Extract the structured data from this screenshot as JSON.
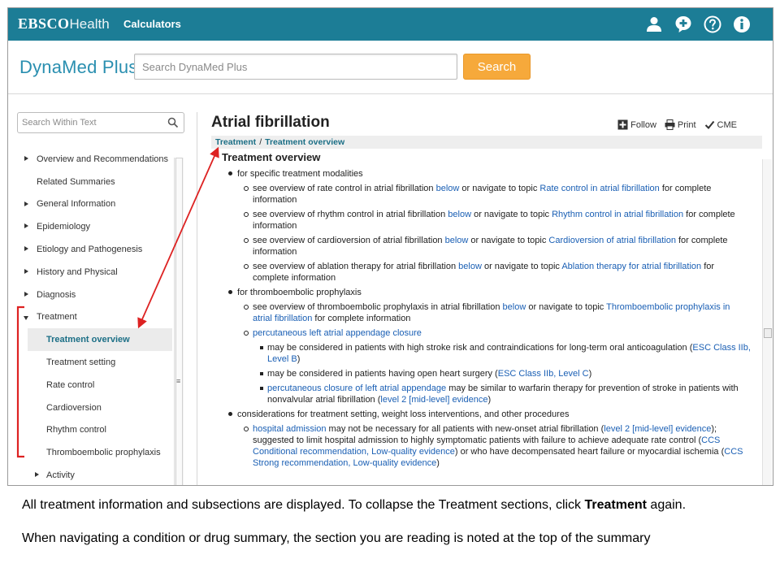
{
  "topbar": {
    "brand_bold": "EBSCO",
    "brand_light": "Health",
    "calculators_label": "Calculators",
    "icons": [
      "user-icon",
      "add-comment-icon",
      "help-icon",
      "info-icon"
    ]
  },
  "header": {
    "logo": "DynaMed Plus",
    "search_placeholder": "Search DynaMed Plus",
    "search_button": "Search",
    "search_button_color": "#f6a93b"
  },
  "sidebar": {
    "search_placeholder": "Search Within Text",
    "items": [
      {
        "label": "Overview and Recommendations",
        "arrow": "right"
      },
      {
        "label": "Related Summaries",
        "arrow": "none"
      },
      {
        "label": "General Information",
        "arrow": "right"
      },
      {
        "label": "Epidemiology",
        "arrow": "right"
      },
      {
        "label": "Etiology and Pathogenesis",
        "arrow": "right"
      },
      {
        "label": "History and Physical",
        "arrow": "right"
      },
      {
        "label": "Diagnosis",
        "arrow": "right"
      },
      {
        "label": "Treatment",
        "arrow": "down"
      },
      {
        "label": "Treatment overview",
        "active": true
      },
      {
        "label": "Treatment setting"
      },
      {
        "label": "Rate control"
      },
      {
        "label": "Cardioversion"
      },
      {
        "label": "Rhythm control"
      },
      {
        "label": "Thromboembolic prophylaxis"
      },
      {
        "label": "Activity",
        "arrow": "right"
      }
    ]
  },
  "main": {
    "title": "Atrial fibrillation",
    "tools": {
      "follow": "Follow",
      "print": "Print",
      "cme": "CME"
    },
    "breadcrumb": {
      "part1": "Treatment",
      "separator": "/",
      "part2": "Treatment overview"
    },
    "section_title": "Treatment overview",
    "b1": "for specific treatment modalities",
    "b1_items": [
      {
        "pre": "see overview of rate control in atrial fibrillation ",
        "link1": "below",
        "mid": " or navigate to topic ",
        "link2": "Rate control in atrial fibrillation",
        "post": " for complete information"
      },
      {
        "pre": "see overview of rhythm control in atrial fibrillation ",
        "link1": "below",
        "mid": " or navigate to topic ",
        "link2": "Rhythm control in atrial fibrillation",
        "post": " for complete information"
      },
      {
        "pre": "see overview of cardioversion of atrial fibrillation ",
        "link1": "below",
        "mid": " or navigate to topic ",
        "link2": "Cardioversion of atrial fibrillation",
        "post": " for complete information"
      },
      {
        "pre": "see overview of ablation therapy for atrial fibrillation ",
        "link1": "below",
        "mid": " or navigate to topic ",
        "link2": "Ablation therapy for atrial fibrillation",
        "post": " for complete information"
      }
    ],
    "b2": "for thromboembolic prophylaxis",
    "b2_item1": {
      "pre": "see overview of thromboembolic prophylaxis in atrial fibrillation ",
      "link1": "below",
      "mid": " or navigate to topic ",
      "link2": "Thromboembolic prophylaxis in atrial fibrillation",
      "post": " for complete information"
    },
    "b2_item2_link": "percutaneous left atrial appendage closure",
    "b2_sub": {
      "s1_text": "may be considered in patients with high stroke risk and contraindications for long-term oral anticoagulation (",
      "s1_link": "ESC Class IIb, Level B",
      "s1_post": ")",
      "s2_text": "may be considered in patients having open heart surgery (",
      "s2_link": "ESC Class IIb, Level C",
      "s2_post": ")",
      "s3_link1": "percutaneous closure of left atrial appendage",
      "s3_text": " may be similar to warfarin therapy for prevention of stroke in patients with nonvalvular atrial fibrillation (",
      "s3_link2": "level 2 [mid-level] evidence",
      "s3_post": ")"
    },
    "b3": "considerations for treatment setting, weight loss interventions, and other procedures",
    "b3_item": {
      "link1": "hospital admission",
      "t1": " may not be necessary for all patients with new-onset atrial fibrillation (",
      "link2": "level 2 [mid-level] evidence",
      "t2": "); suggested to limit hospital admission to highly symptomatic patients with failure to achieve adequate rate control (",
      "link3": "CCS Conditional recommendation, Low-quality evidence",
      "t3": ") or who have decompensated heart failure or myocardial ischemia (",
      "link4": "CCS Strong recommendation, Low-quality evidence",
      "t4": ")"
    }
  },
  "annotation_color": "#dd2222",
  "caption": {
    "p1_text": "All treatment information and subsections are displayed. To collapse the Treatment sections, click ",
    "p1_bold": "Treatment",
    "p1_end": " again.",
    "p2_text": "When navigating a condition or drug summary, the section you are reading is noted at the top of the summary"
  }
}
